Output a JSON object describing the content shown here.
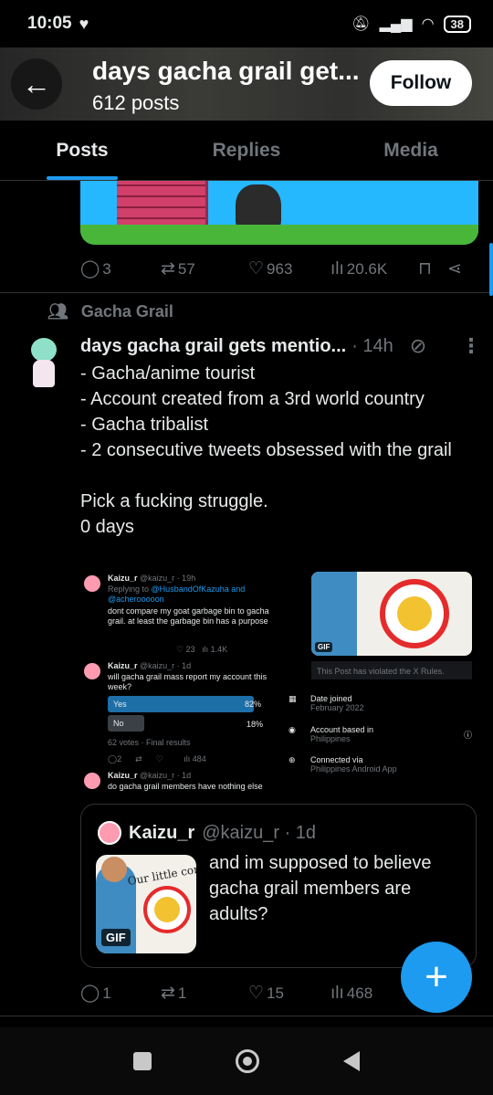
{
  "status_bar": {
    "time": "10:05",
    "battery": "38"
  },
  "header": {
    "title": "days gacha grail get...",
    "posts_count": "612 posts",
    "follow_label": "Follow"
  },
  "tabs": [
    {
      "label": "Posts"
    },
    {
      "label": "Replies"
    },
    {
      "label": "Media"
    }
  ],
  "prev_post": {
    "replies": "3",
    "reposts": "57",
    "likes": "963",
    "views": "20.6K"
  },
  "post": {
    "community": "Gacha Grail",
    "name": "days gacha grail gets mentio...",
    "time": "· 14h",
    "text": "- Gacha/anime tourist\n- Account created from a 3rd world country\n- Gacha tribalist\n- 2 consecutive tweets obsessed with the grail\n\nPick a fucking struggle.\n0 days",
    "screenshot": {
      "t1_name": "Kaizu_r",
      "t1_meta": "@kaizu_r · 19h",
      "t1_reply_prefix": "Replying to",
      "t1_reply_handles": "@HusbandOfKazuha and @acherooooon",
      "t1_body": "dont compare my goat garbage bin to gacha grail. at least the garbage bin has a purpose",
      "t1_likes": "23",
      "t1_views": "1.4K",
      "t2_name": "Kaizu_r",
      "t2_meta": "@kaizu_r · 1d",
      "t2_body": "will gacha grail mass report my account this week?",
      "poll_yes": "Yes",
      "poll_yes_pct": "82%",
      "poll_yes_value": 82,
      "poll_no": "No",
      "poll_no_pct": "18%",
      "poll_no_value": 18,
      "poll_footer": "62 votes · Final results",
      "t2_replies": "2",
      "t2_views": "484",
      "t3_name": "Kaizu_r",
      "t3_meta": "@kaizu_r · 1d",
      "t3_body": "do gacha grail members have nothing else",
      "gif_label": "GIF",
      "violated": "This Post has violated the X Rules.",
      "date_joined_label": "Date joined",
      "date_joined_value": "February 2022",
      "based_label": "Account based in",
      "based_value": "Philippines",
      "connected_label": "Connected via",
      "connected_value": "Philippines Android App"
    },
    "quote": {
      "name": "Kaizu_r",
      "meta": "@kaizu_r · 1d",
      "text": "and im supposed to believe gacha grail members are adults?",
      "image_caption": "Our little comedian",
      "gif_label": "GIF"
    },
    "replies": "1",
    "reposts": "1",
    "likes": "15",
    "views": "468"
  },
  "colors": {
    "accent": "#1d9bf0",
    "muted": "#71767b",
    "text": "#e7e9ea",
    "border": "#2f3336"
  }
}
